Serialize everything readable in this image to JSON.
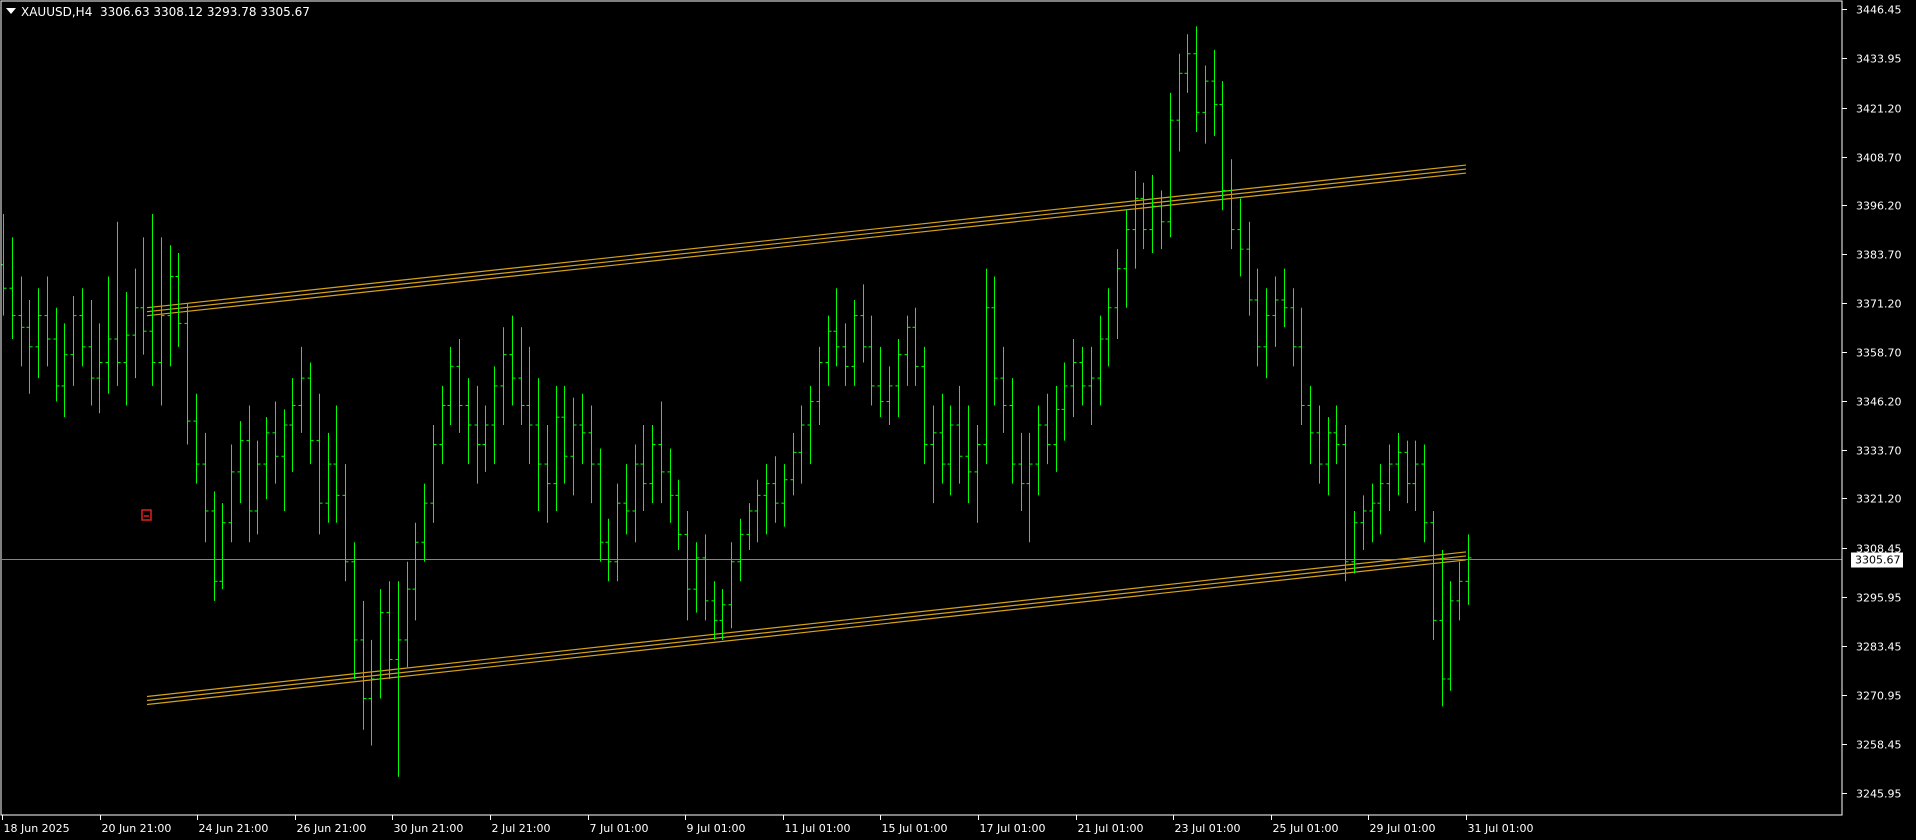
{
  "header": {
    "symbol": "XAUUSD,H4",
    "ohlc": "3306.63 3308.12 3293.78 3305.67"
  },
  "colors": {
    "background": "#000000",
    "bar": "#00ff00",
    "channel": "#d4a21a",
    "price_line": "#778899",
    "axis": "#ffffff"
  },
  "current_price_label": "3305.67",
  "chart_data": {
    "type": "ohlc-bar",
    "ylim": [
      3240.2,
      3448.5
    ],
    "y_ticks": [
      "3446.45",
      "3433.95",
      "3421.20",
      "3408.70",
      "3396.20",
      "3383.70",
      "3371.20",
      "3358.70",
      "3346.20",
      "3333.70",
      "3321.20",
      "3308.45",
      "3295.95",
      "3283.45",
      "3270.95",
      "3258.45",
      "3245.95"
    ],
    "x_ticks": [
      "18 Jun 2025",
      "20 Jun 21:00",
      "24 Jun 21:00",
      "26 Jun 21:00",
      "30 Jun 21:00",
      "2 Jul 21:00",
      "7 Jul 01:00",
      "9 Jul 01:00",
      "11 Jul 01:00",
      "15 Jul 01:00",
      "17 Jul 01:00",
      "21 Jul 01:00",
      "23 Jul 01:00",
      "25 Jul 01:00",
      "29 Jul 01:00",
      "31 Jul 01:00"
    ],
    "current_price": 3305.67,
    "channel": {
      "upper": {
        "start": 3369.0,
        "end": 3405.5
      },
      "lower": {
        "start": 3269.5,
        "end": 3306.5
      }
    },
    "bars": [
      [
        3381,
        3394,
        3368,
        3375
      ],
      [
        3375,
        3388,
        3362,
        3368
      ],
      [
        3368,
        3378,
        3355,
        3365
      ],
      [
        3365,
        3372,
        3348,
        3360
      ],
      [
        3360,
        3375,
        3352,
        3368
      ],
      [
        3368,
        3378,
        3355,
        3362
      ],
      [
        3362,
        3370,
        3346,
        3350
      ],
      [
        3350,
        3366,
        3342,
        3358
      ],
      [
        3358,
        3373,
        3350,
        3368
      ],
      [
        3368,
        3375,
        3355,
        3360
      ],
      [
        3360,
        3372,
        3345,
        3352
      ],
      [
        3352,
        3366,
        3343,
        3356
      ],
      [
        3356,
        3378,
        3348,
        3362
      ],
      [
        3362,
        3392,
        3350,
        3356
      ],
      [
        3356,
        3374,
        3345,
        3363
      ],
      [
        3363,
        3380,
        3352,
        3370
      ],
      [
        3370,
        3388,
        3358,
        3364
      ],
      [
        3364,
        3394,
        3350,
        3356
      ],
      [
        3356,
        3388,
        3345,
        3368
      ],
      [
        3368,
        3386,
        3355,
        3378
      ],
      [
        3378,
        3384,
        3360,
        3366
      ],
      [
        3366,
        3371,
        3335,
        3341
      ],
      [
        3341,
        3348,
        3325,
        3330
      ],
      [
        3330,
        3338,
        3310,
        3318
      ],
      [
        3318,
        3323,
        3295,
        3300
      ],
      [
        3300,
        3320,
        3298,
        3315
      ],
      [
        3315,
        3335,
        3310,
        3328
      ],
      [
        3328,
        3341,
        3320,
        3336
      ],
      [
        3336,
        3345,
        3310,
        3318
      ],
      [
        3318,
        3336,
        3312,
        3330
      ],
      [
        3330,
        3342,
        3321,
        3338
      ],
      [
        3338,
        3346,
        3325,
        3332
      ],
      [
        3332,
        3344,
        3318,
        3340
      ],
      [
        3340,
        3352,
        3328,
        3345
      ],
      [
        3345,
        3360,
        3338,
        3352
      ],
      [
        3352,
        3356,
        3330,
        3336
      ],
      [
        3336,
        3348,
        3312,
        3320
      ],
      [
        3320,
        3338,
        3315,
        3330
      ],
      [
        3330,
        3345,
        3315,
        3322
      ],
      [
        3322,
        3330,
        3300,
        3305
      ],
      [
        3305,
        3310,
        3275,
        3285
      ],
      [
        3285,
        3295,
        3262,
        3270
      ],
      [
        3270,
        3285,
        3258,
        3275
      ],
      [
        3275,
        3298,
        3270,
        3292
      ],
      [
        3292,
        3300,
        3275,
        3280
      ],
      [
        3280,
        3300,
        3250,
        3285
      ],
      [
        3285,
        3305,
        3278,
        3298
      ],
      [
        3298,
        3315,
        3290,
        3310
      ],
      [
        3310,
        3325,
        3305,
        3320
      ],
      [
        3320,
        3340,
        3315,
        3335
      ],
      [
        3335,
        3350,
        3330,
        3345
      ],
      [
        3345,
        3360,
        3340,
        3355
      ],
      [
        3355,
        3362,
        3338,
        3345
      ],
      [
        3345,
        3352,
        3330,
        3340
      ],
      [
        3340,
        3350,
        3325,
        3335
      ],
      [
        3335,
        3345,
        3328,
        3340
      ],
      [
        3340,
        3355,
        3330,
        3350
      ],
      [
        3350,
        3365,
        3340,
        3358
      ],
      [
        3358,
        3368,
        3345,
        3352
      ],
      [
        3352,
        3365,
        3340,
        3345
      ],
      [
        3345,
        3360,
        3330,
        3340
      ],
      [
        3340,
        3352,
        3318,
        3330
      ],
      [
        3330,
        3340,
        3315,
        3325
      ],
      [
        3325,
        3350,
        3318,
        3342
      ],
      [
        3342,
        3350,
        3325,
        3332
      ],
      [
        3332,
        3347,
        3322,
        3340
      ],
      [
        3340,
        3348,
        3330,
        3338
      ],
      [
        3338,
        3345,
        3320,
        3330
      ],
      [
        3330,
        3334,
        3305,
        3310
      ],
      [
        3310,
        3316,
        3300,
        3305
      ],
      [
        3305,
        3325,
        3300,
        3320
      ],
      [
        3320,
        3330,
        3312,
        3318
      ],
      [
        3318,
        3335,
        3310,
        3330
      ],
      [
        3330,
        3340,
        3318,
        3325
      ],
      [
        3325,
        3340,
        3320,
        3335
      ],
      [
        3335,
        3346,
        3320,
        3328
      ],
      [
        3328,
        3334,
        3315,
        3322
      ],
      [
        3322,
        3326,
        3308,
        3312
      ],
      [
        3312,
        3318,
        3290,
        3298
      ],
      [
        3298,
        3310,
        3292,
        3306
      ],
      [
        3306,
        3312,
        3290,
        3295
      ],
      [
        3295,
        3300,
        3285,
        3290
      ],
      [
        3290,
        3298,
        3285,
        3294
      ],
      [
        3294,
        3310,
        3288,
        3305
      ],
      [
        3305,
        3316,
        3300,
        3312
      ],
      [
        3312,
        3320,
        3308,
        3318
      ],
      [
        3318,
        3326,
        3310,
        3322
      ],
      [
        3322,
        3330,
        3312,
        3325
      ],
      [
        3325,
        3332,
        3315,
        3320
      ],
      [
        3320,
        3330,
        3314,
        3326
      ],
      [
        3326,
        3338,
        3322,
        3333
      ],
      [
        3333,
        3345,
        3325,
        3340
      ],
      [
        3340,
        3350,
        3330,
        3346
      ],
      [
        3346,
        3360,
        3340,
        3356
      ],
      [
        3356,
        3368,
        3350,
        3364
      ],
      [
        3364,
        3375,
        3355,
        3360
      ],
      [
        3360,
        3366,
        3350,
        3355
      ],
      [
        3355,
        3372,
        3350,
        3368
      ],
      [
        3368,
        3376,
        3356,
        3360
      ],
      [
        3360,
        3368,
        3345,
        3350
      ],
      [
        3350,
        3360,
        3342,
        3346
      ],
      [
        3346,
        3355,
        3340,
        3350
      ],
      [
        3350,
        3362,
        3342,
        3358
      ],
      [
        3358,
        3368,
        3350,
        3365
      ],
      [
        3365,
        3370,
        3350,
        3355
      ],
      [
        3355,
        3360,
        3330,
        3335
      ],
      [
        3335,
        3345,
        3320,
        3338
      ],
      [
        3338,
        3348,
        3325,
        3330
      ],
      [
        3330,
        3345,
        3322,
        3340
      ],
      [
        3340,
        3350,
        3325,
        3332
      ],
      [
        3332,
        3345,
        3320,
        3328
      ],
      [
        3328,
        3340,
        3315,
        3335
      ],
      [
        3335,
        3380,
        3330,
        3370
      ],
      [
        3370,
        3378,
        3345,
        3352
      ],
      [
        3352,
        3360,
        3338,
        3345
      ],
      [
        3345,
        3352,
        3325,
        3330
      ],
      [
        3330,
        3338,
        3318,
        3325
      ],
      [
        3325,
        3338,
        3310,
        3330
      ],
      [
        3330,
        3345,
        3322,
        3340
      ],
      [
        3340,
        3348,
        3330,
        3335
      ],
      [
        3335,
        3350,
        3328,
        3344
      ],
      [
        3344,
        3356,
        3336,
        3350
      ],
      [
        3350,
        3362,
        3342,
        3356
      ],
      [
        3356,
        3360,
        3345,
        3350
      ],
      [
        3350,
        3360,
        3340,
        3352
      ],
      [
        3352,
        3368,
        3345,
        3362
      ],
      [
        3362,
        3375,
        3355,
        3370
      ],
      [
        3370,
        3385,
        3362,
        3380
      ],
      [
        3380,
        3395,
        3370,
        3390
      ],
      [
        3390,
        3405,
        3380,
        3398
      ],
      [
        3398,
        3402,
        3385,
        3390
      ],
      [
        3390,
        3404,
        3384,
        3396
      ],
      [
        3396,
        3400,
        3385,
        3392
      ],
      [
        3392,
        3425,
        3388,
        3418
      ],
      [
        3418,
        3435,
        3410,
        3430
      ],
      [
        3430,
        3440,
        3425,
        3435
      ],
      [
        3435,
        3442,
        3415,
        3420
      ],
      [
        3420,
        3432,
        3412,
        3428
      ],
      [
        3428,
        3436,
        3414,
        3422
      ],
      [
        3422,
        3428,
        3395,
        3400
      ],
      [
        3400,
        3408,
        3385,
        3390
      ],
      [
        3390,
        3398,
        3378,
        3385
      ],
      [
        3385,
        3392,
        3368,
        3372
      ],
      [
        3372,
        3380,
        3355,
        3360
      ],
      [
        3360,
        3375,
        3352,
        3368
      ],
      [
        3368,
        3378,
        3360,
        3372
      ],
      [
        3372,
        3380,
        3365,
        3370
      ],
      [
        3370,
        3375,
        3355,
        3360
      ],
      [
        3360,
        3370,
        3340,
        3345
      ],
      [
        3345,
        3350,
        3330,
        3338
      ],
      [
        3338,
        3345,
        3325,
        3330
      ],
      [
        3330,
        3342,
        3322,
        3338
      ],
      [
        3338,
        3345,
        3330,
        3335
      ],
      [
        3335,
        3340,
        3300,
        3305
      ],
      [
        3305,
        3318,
        3302,
        3315
      ],
      [
        3315,
        3322,
        3308,
        3318
      ],
      [
        3318,
        3325,
        3310,
        3320
      ],
      [
        3320,
        3330,
        3312,
        3325
      ],
      [
        3325,
        3335,
        3318,
        3330
      ],
      [
        3330,
        3338,
        3322,
        3333
      ],
      [
        3333,
        3336,
        3320,
        3325
      ],
      [
        3325,
        3336,
        3318,
        3330
      ],
      [
        3330,
        3335,
        3310,
        3315
      ],
      [
        3315,
        3318,
        3285,
        3290
      ],
      [
        3290,
        3308,
        3268,
        3275
      ],
      [
        3275,
        3300,
        3272,
        3295
      ],
      [
        3295,
        3305,
        3290,
        3300
      ],
      [
        3300,
        3312,
        3294,
        3306
      ]
    ]
  }
}
